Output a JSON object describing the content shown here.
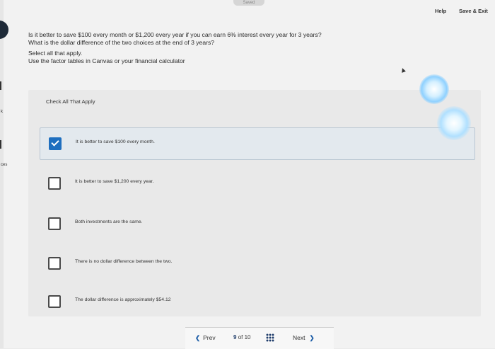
{
  "header": {
    "saved_label": "Saved",
    "help_label": "Help",
    "save_exit_label": "Save & Exit"
  },
  "sidebar_fragments": [
    "k",
    "ces"
  ],
  "question": {
    "line1": "Is it better to save $100 every month or $1,200 every year if you can earn 6% interest every year for 3 years?",
    "line2": "What is the dollar difference of the two choices at the end of 3 years?"
  },
  "instructions": {
    "line1": "Select all that apply.",
    "line2": "Use the factor tables in Canvas or your financial calculator"
  },
  "check_all": {
    "title": "Check All That Apply"
  },
  "choices": [
    {
      "label": "It is better to save $100 every month.",
      "checked": true
    },
    {
      "label": "It is better to save $1,200 every year.",
      "checked": false
    },
    {
      "label": "Both investments are the same.",
      "checked": false
    },
    {
      "label": "There is no dollar difference between the two.",
      "checked": false
    },
    {
      "label": "The dollar difference is approximately $54.12",
      "checked": false
    }
  ],
  "nav": {
    "prev_label": "Prev",
    "current_page": "9",
    "of_label": "of",
    "total_pages": "10",
    "next_label": "Next"
  },
  "colors": {
    "accent": "#1f6fbf",
    "nav_icon": "#1f3d6b"
  }
}
